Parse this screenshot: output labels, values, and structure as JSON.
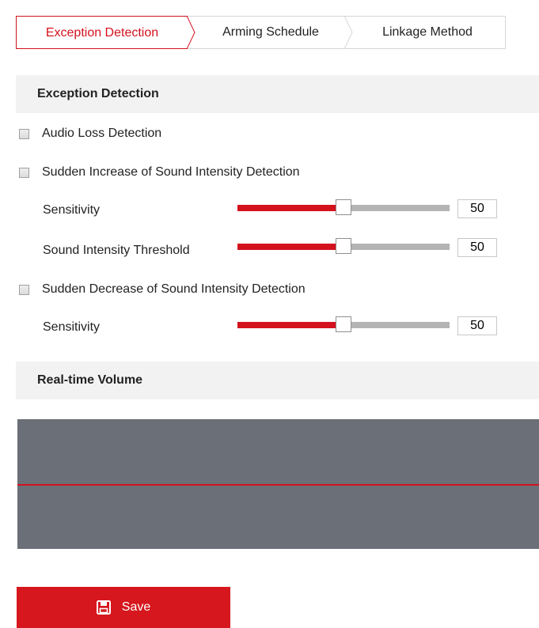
{
  "tabs": [
    {
      "label": "Exception Detection",
      "active": true
    },
    {
      "label": "Arming Schedule",
      "active": false
    },
    {
      "label": "Linkage Method",
      "active": false
    }
  ],
  "exception_section": {
    "title": "Exception Detection",
    "audio_loss": {
      "label": "Audio Loss Detection",
      "checked": false
    },
    "sudden_increase": {
      "label": "Sudden Increase of Sound Intensity Detection",
      "checked": false,
      "sensitivity": {
        "label": "Sensitivity",
        "value": "50",
        "fraction": 0.5
      },
      "threshold": {
        "label": "Sound Intensity Threshold",
        "value": "50",
        "fraction": 0.5
      }
    },
    "sudden_decrease": {
      "label": "Sudden Decrease of Sound Intensity Detection",
      "checked": false,
      "sensitivity": {
        "label": "Sensitivity",
        "value": "50",
        "fraction": 0.5
      }
    }
  },
  "volume_section": {
    "title": "Real-time Volume",
    "threshold_level": 0.5
  },
  "save_button": {
    "label": "Save",
    "icon": "save-icon"
  },
  "colors": {
    "accent": "#d4121e",
    "volume_bg": "#6b6f77",
    "track": "#b4b4b4"
  }
}
